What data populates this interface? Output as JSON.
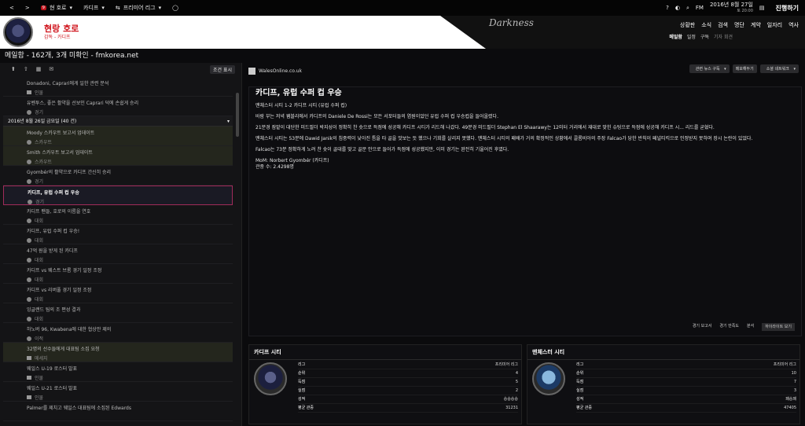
{
  "topbar": {
    "back": "<",
    "forward": ">",
    "mail_count": "9",
    "club": "현 호로",
    "team": "카디프",
    "league": "프리미어 리그",
    "date": "2016년 8월 27일",
    "time": "토 20:00",
    "proceed": "진행하기",
    "fm": "FM"
  },
  "header": {
    "club_name": "현랑 호로",
    "club_sub": "감독 - 카디프",
    "skin": "Darkness",
    "menu": [
      "상황판",
      "소식",
      "검색",
      "명단",
      "계약",
      "일자리",
      "역사"
    ],
    "submenu": [
      "메일함",
      "일정",
      "구독",
      "기자 회견"
    ]
  },
  "title": "메일함 - 162개, 3개 미확인 - fmkorea.net",
  "left": {
    "filter": "조건 표시",
    "items": [
      {
        "title": "Donadoni, Caprari에게 일한 관련 분석",
        "meta": "인물",
        "style": "",
        "icon": "sqr"
      },
      {
        "title": "유벤투스, 좋은 활약을 선보인 Caprari 덕에 손쉽게 승리",
        "meta": "경기",
        "style": "",
        "icon": "dot"
      }
    ],
    "date_group": "2016년 8월 26일 금요일 (40 건)",
    "items2": [
      {
        "title": "Moody 스카우트 보고서 업데이트",
        "meta": "스카우트",
        "style": "highlight",
        "icon": "dot"
      },
      {
        "title": "Smith 스카우트 보고서 업데이트",
        "meta": "스카우트",
        "style": "highlight",
        "icon": "dot"
      },
      {
        "title": "Gyombér의 활약으로 카디프 간신히 승리",
        "meta": "경기",
        "style": "",
        "icon": "dot"
      },
      {
        "title": "카디프, 유럽 수퍼 컵 우승",
        "meta": "경기",
        "style": "selected",
        "icon": "dot"
      },
      {
        "title": "카디프 팬들, 호로의 이름을 연호",
        "meta": "대회",
        "style": "",
        "icon": "dot"
      },
      {
        "title": "카디프, 유럽 수퍼 컵 우승!",
        "meta": "대회",
        "style": "",
        "icon": "dot"
      },
      {
        "title": "47억 원을 받게 된 카디프",
        "meta": "대회",
        "style": "",
        "icon": "dot"
      },
      {
        "title": "카디프 vs 웨스트 브롬 경기 일정 조정",
        "meta": "대회",
        "style": "",
        "icon": "dot"
      },
      {
        "title": "카디프 vs 리버풀 경기 일정 조정",
        "meta": "대회",
        "style": "",
        "icon": "dot"
      },
      {
        "title": "잉글랜드 팀의 조 편성 결과",
        "meta": "대회",
        "style": "",
        "icon": "dot"
      },
      {
        "title": "하노버 96, Kwabena에 대한 협상안 제의",
        "meta": "이적",
        "style": "",
        "icon": "dot"
      },
      {
        "title": "32명의 선수들에게 대표팀 소집 요청",
        "meta": "메세지",
        "style": "highlight",
        "icon": "sqr"
      },
      {
        "title": "웨일스 U-19 로스터 발표",
        "meta": "인물",
        "style": "",
        "icon": "sqr"
      },
      {
        "title": "웨일스 U-21 로스터 발표",
        "meta": "인물",
        "style": "",
        "icon": "sqr"
      },
      {
        "title": "Palmer를 제치고 웨일스 대표팀에 소집된 Edwards",
        "meta": "",
        "style": "",
        "icon": "sqr"
      }
    ]
  },
  "main": {
    "source": "WalesOnline.co.uk",
    "buttons": [
      "관련 뉴스 구독",
      "메모해두기",
      "소셜 네트워크"
    ],
    "headline": "카디프, 유럽 수퍼 컵 우승",
    "paragraphs": [
      "맨체스터 시티 1-2 카디프 시티 (유럽 수퍼 컵)",
      "바람 부는 저녁 웸블리에서 카디프의 Daniele De Rossi는 모든 서포터들의 염원이었던 유럽 수퍼 컵 우승컵을 들어올렸다.",
      "21분경 잠밭이 대단한 미드필더 박지성이 정확히 찬 슛으로 득점에 성공해 카디프 시티가 리드해 나갔다. 49분경 미드필더 Stephan El Shaarawy는 12미터 거리에서 재대로 맞힌 슈팅으로 득점에 성공해 카디프 시... 리드를 굳혔다.",
      "맨체스터 시티는 53분에 Dawid Janik의 침중력이 낮아진 틈을 타 골을 맛보는 듯 했으나 기회를 살리지 못했다. 맨체스터 시티의 패배가 거의 확정적인 상황에서 콜롬비아의 주장 Falcao가 당한 반칙이 페널티킥으로 인정받지 못하며 장시 논란이 있었다.",
      "Falcao는 73분 정확하게 노려 찬 슛이 골대를 맞고 골문 안으로 들어가 득점에 성공했지만, 이미 경기는 완전히 기울어진 후였다.",
      "MoM: Norbert Gyombér (카디프)",
      "관중 수: 2.4298명"
    ],
    "footer": [
      "경기 보고서",
      "경기 만족도",
      "분석",
      "하이라이트 보기"
    ]
  },
  "cards": [
    {
      "name": "카디프 시티",
      "rows": [
        [
          "리그",
          "프리미어 리그"
        ],
        [
          "순위",
          "4"
        ],
        [
          "득점",
          "5"
        ],
        [
          "실점",
          "2"
        ],
        [
          "성적",
          "승승승승"
        ],
        [
          "평균 관중",
          "31231"
        ]
      ]
    },
    {
      "name": "맨체스터 시티",
      "rows": [
        [
          "리그",
          "프리미어 리그"
        ],
        [
          "순위",
          "10"
        ],
        [
          "득점",
          "7"
        ],
        [
          "실점",
          "3"
        ],
        [
          "성적",
          "패승패"
        ],
        [
          "평균 관중",
          "47405"
        ]
      ]
    }
  ]
}
